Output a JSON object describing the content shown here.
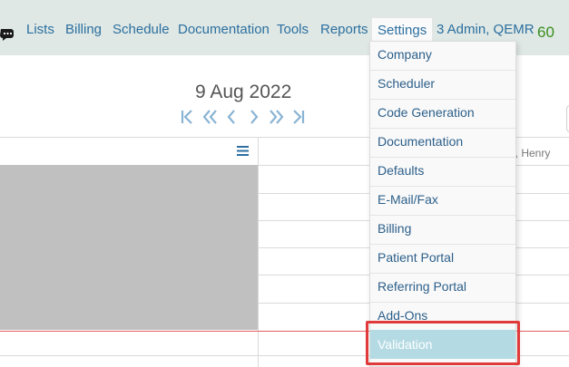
{
  "nav": {
    "items": [
      "Lists",
      "Billing",
      "Schedule",
      "Documentation",
      "Tools",
      "Reports"
    ],
    "settings_label": "Settings",
    "user_label": "3 Admin, QEMR",
    "count": "60"
  },
  "schedule": {
    "date": "9 Aug 2022",
    "column_header": "l, Henry"
  },
  "settings_menu": {
    "items": [
      "Company",
      "Scheduler",
      "Code Generation",
      "Documentation",
      "Defaults",
      "E-Mail/Fax",
      "Billing",
      "Patient Portal",
      "Referring Portal",
      "Add-Ons",
      "Validation"
    ],
    "active": "Validation"
  },
  "colors": {
    "navbar_bg": "#dfe8e4",
    "link": "#2c6fa0",
    "count_green": "#3a8e1e",
    "active_item_bg": "#b4dae3",
    "highlight_red": "#e03a3a"
  }
}
